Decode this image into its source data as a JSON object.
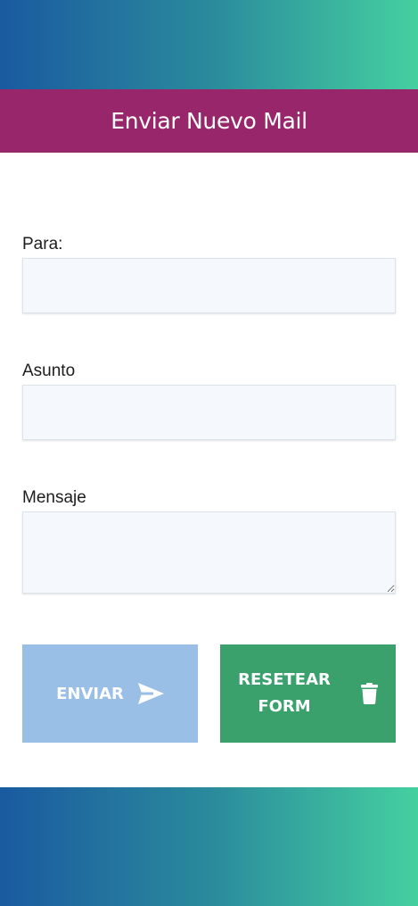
{
  "header": {
    "title": "Enviar Nuevo Mail"
  },
  "form": {
    "to": {
      "label": "Para:",
      "value": "",
      "placeholder": ""
    },
    "subject": {
      "label": "Asunto",
      "value": "",
      "placeholder": ""
    },
    "message": {
      "label": "Mensaje",
      "value": "",
      "placeholder": ""
    }
  },
  "buttons": {
    "send": {
      "label": "ENVIAR",
      "icon": "paper-plane-icon"
    },
    "reset": {
      "label": "RESETEAR\nFORM",
      "icon": "trash-icon"
    }
  },
  "colors": {
    "title_bar": "#97266a",
    "gradient_start": "#1a5aa0",
    "gradient_end": "#45d0a0",
    "send_button": "#99bfe6",
    "reset_button": "#3aa06c",
    "input_background": "#f5f8fc"
  }
}
